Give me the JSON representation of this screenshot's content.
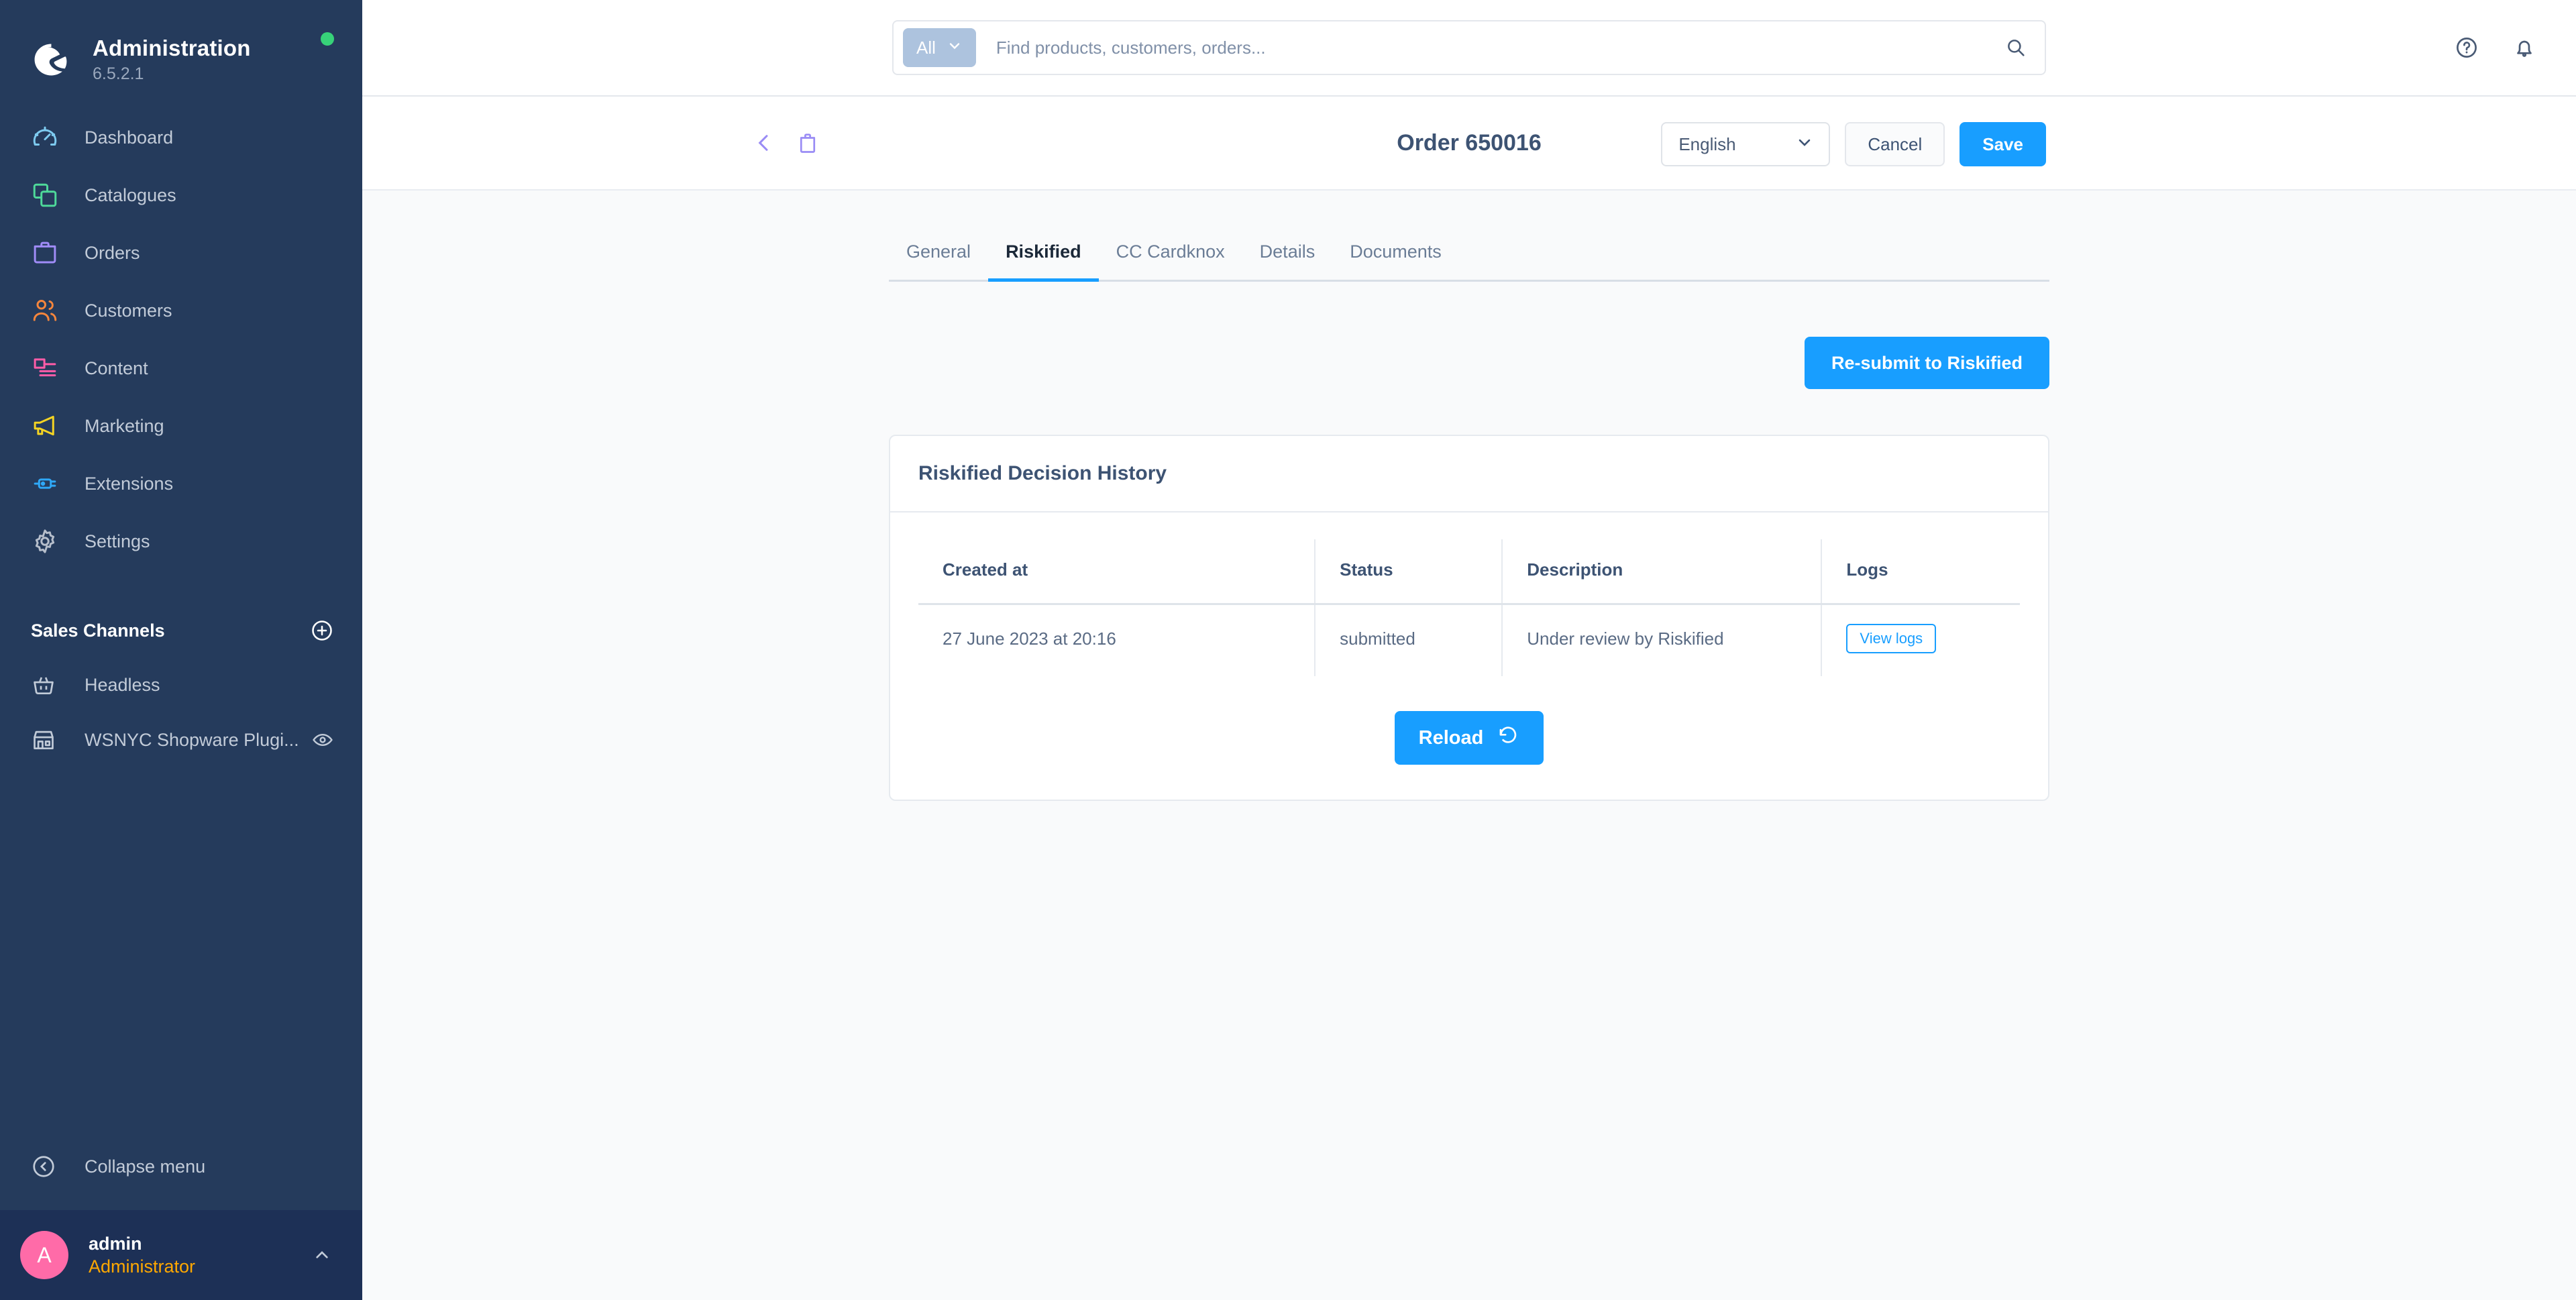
{
  "sidebar": {
    "brand": {
      "title": "Administration",
      "version": "6.5.2.1",
      "logo_icon": "shopware-logo-icon",
      "status_dot_color": "#37d279"
    },
    "items": [
      {
        "label": "Dashboard",
        "icon": "gauge-icon",
        "color": "#7ecbf0"
      },
      {
        "label": "Catalogues",
        "icon": "layers-icon",
        "color": "#4ed99a"
      },
      {
        "label": "Orders",
        "icon": "bag-icon",
        "color": "#a08cf7"
      },
      {
        "label": "Customers",
        "icon": "users-icon",
        "color": "#f7863c"
      },
      {
        "label": "Content",
        "icon": "content-icon",
        "color": "#ff5ca8"
      },
      {
        "label": "Marketing",
        "icon": "megaphone-icon",
        "color": "#f5d423"
      },
      {
        "label": "Extensions",
        "icon": "plug-icon",
        "color": "#2fa8f7"
      },
      {
        "label": "Settings",
        "icon": "gear-icon",
        "color": "#b6becb"
      }
    ],
    "sales_channels": {
      "title": "Sales Channels",
      "add_icon": "plus-circle-icon",
      "items": [
        {
          "label": "Headless",
          "icon": "basket-icon",
          "has_eye": false
        },
        {
          "label": "WSNYC Shopware Plugi...",
          "icon": "storefront-icon",
          "has_eye": true,
          "eye_icon": "eye-icon"
        }
      ]
    },
    "collapse": {
      "label": "Collapse menu",
      "icon": "chevron-left-circle-icon"
    },
    "user": {
      "initial": "A",
      "name": "admin",
      "role": "Administrator",
      "caret_icon": "chevron-up-icon",
      "avatar_color": "#ff6ba8",
      "role_color": "#ffa800"
    }
  },
  "topbar": {
    "search": {
      "scope_label": "All",
      "scope_caret_icon": "chevron-down-icon",
      "placeholder": "Find products, customers, orders...",
      "value": "",
      "search_icon": "search-icon"
    },
    "help_icon": "help-circle-icon",
    "notifications_icon": "bell-icon"
  },
  "pageheader": {
    "back_icon": "chevron-left-icon",
    "order_icon": "order-bag-icon",
    "title": "Order 650016",
    "language": {
      "value": "English",
      "caret_icon": "chevron-down-icon"
    },
    "cancel_label": "Cancel",
    "save_label": "Save"
  },
  "main": {
    "tabs": [
      {
        "label": "General",
        "active": false
      },
      {
        "label": "Riskified",
        "active": true
      },
      {
        "label": "CC Cardknox",
        "active": false
      },
      {
        "label": "Details",
        "active": false
      },
      {
        "label": "Documents",
        "active": false
      }
    ],
    "resubmit_label": "Re-submit to Riskified",
    "card": {
      "title": "Riskified Decision History",
      "columns": [
        "Created at",
        "Status",
        "Description",
        "Logs"
      ],
      "rows": [
        {
          "created_at": "27 June 2023 at 20:16",
          "status": "submitted",
          "description": "Under review by Riskified",
          "logs_label": "View logs"
        }
      ],
      "reload_label": "Reload",
      "reload_icon": "refresh-icon"
    }
  },
  "colors": {
    "accent": "#189eff",
    "sidebar_bg": "#253b5c",
    "content_bg": "#f9fafb",
    "heading": "#3d5373"
  }
}
